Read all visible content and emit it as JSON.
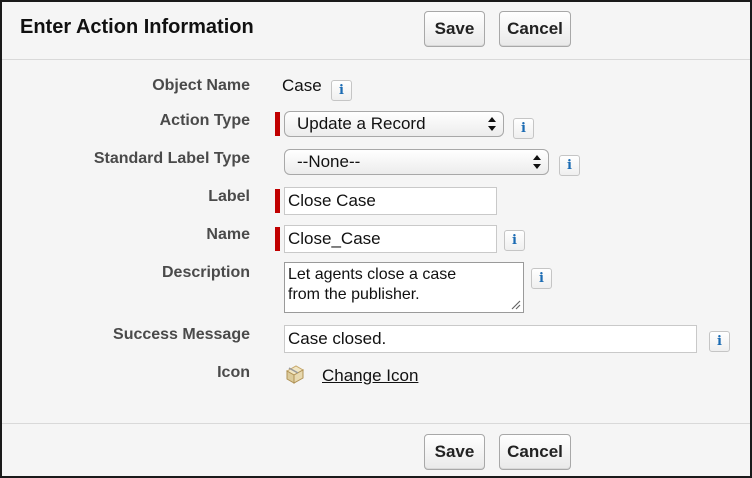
{
  "header": {
    "title": "Enter Action Information",
    "save_label": "Save",
    "cancel_label": "Cancel"
  },
  "fields": {
    "object_name": {
      "label": "Object Name",
      "value": "Case",
      "info_glyph": "i"
    },
    "action_type": {
      "label": "Action Type",
      "value": "Update a Record",
      "required": true,
      "info_glyph": "i"
    },
    "standard_label_type": {
      "label": "Standard Label Type",
      "value": "--None--",
      "info_glyph": "i"
    },
    "label": {
      "label": "Label",
      "value": "Close Case",
      "required": true
    },
    "name": {
      "label": "Name",
      "value": "Close_Case",
      "required": true,
      "info_glyph": "i"
    },
    "description": {
      "label": "Description",
      "line1": "Let agents close a case",
      "line2": "from the publisher.",
      "info_glyph": "i"
    },
    "success_message": {
      "label": "Success Message",
      "value": "Case closed.",
      "info_glyph": "i"
    },
    "icon": {
      "label": "Icon",
      "icon_name": "package-icon",
      "link_text": "Change Icon"
    }
  },
  "footer": {
    "save_label": "Save",
    "cancel_label": "Cancel"
  },
  "colors": {
    "required_marker": "#c00000",
    "info_icon": "#1b6bb3",
    "panel_background": "#f5f5f5"
  }
}
